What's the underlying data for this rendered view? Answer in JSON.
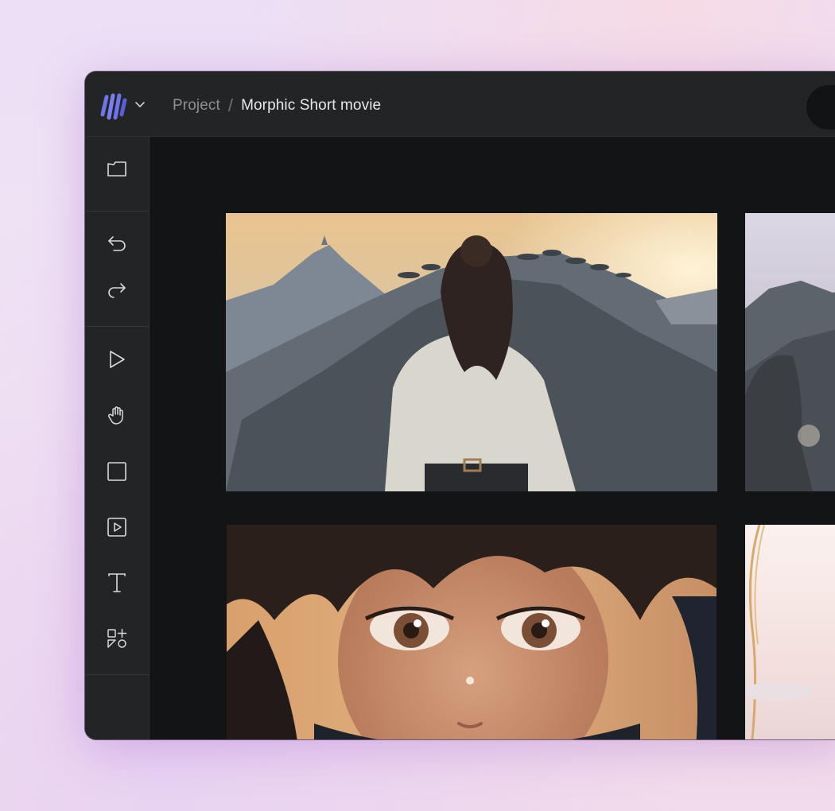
{
  "app": {
    "logo_icon": "morphic-logo-icon",
    "accent": "#6f74e8"
  },
  "breadcrumb": {
    "parent": "Project",
    "separator": "/",
    "current": "Morphic Short movie"
  },
  "toolbar": {
    "tools": [
      {
        "name": "folder-icon"
      },
      {
        "name": "undo-icon"
      },
      {
        "name": "redo-icon"
      },
      {
        "name": "select-arrow-icon"
      },
      {
        "name": "hand-pan-icon"
      },
      {
        "name": "rectangle-icon"
      },
      {
        "name": "video-frame-icon"
      },
      {
        "name": "text-icon"
      },
      {
        "name": "add-widget-icon"
      }
    ]
  },
  "canvas": {
    "frames": [
      {
        "name": "girl-on-hill-frame"
      },
      {
        "name": "misty-mountains-frame"
      },
      {
        "name": "girl-closeup-frame"
      },
      {
        "name": "bright-sky-frame"
      }
    ]
  }
}
